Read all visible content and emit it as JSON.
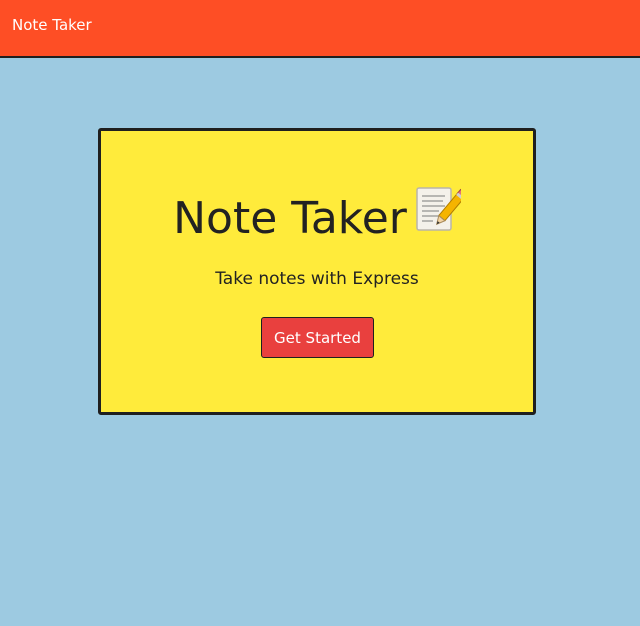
{
  "navbar": {
    "brand": "Note Taker"
  },
  "hero": {
    "title": "Note Taker",
    "title_icon": "memo-icon",
    "subtitle": "Take notes with Express",
    "cta_label": "Get Started"
  },
  "colors": {
    "navbar_bg": "#fe4e25",
    "page_bg": "#9dcae1",
    "card_bg": "#ffeb3b",
    "button_bg": "#e9403e"
  }
}
